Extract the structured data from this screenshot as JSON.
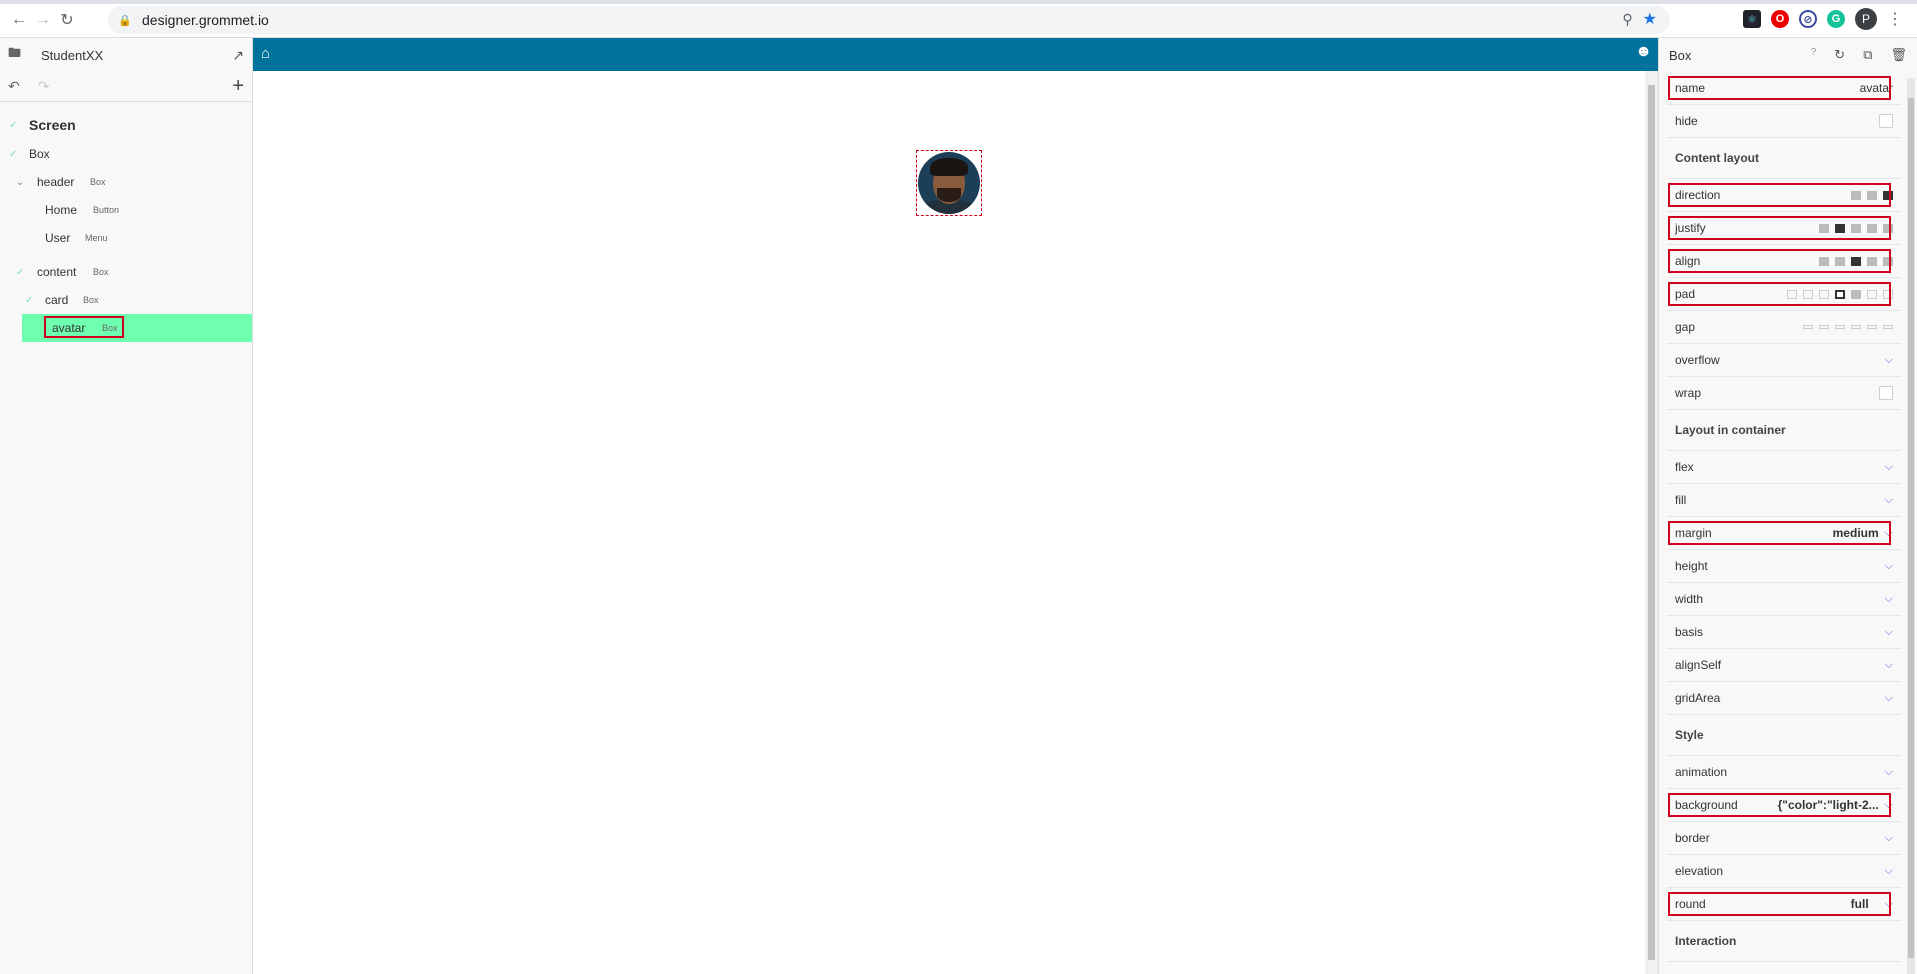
{
  "browser": {
    "url": "designer.grommet.io",
    "profile_initial": "P"
  },
  "left_panel": {
    "project_name": "StudentXX",
    "tree": [
      {
        "label": "Screen",
        "type": ""
      },
      {
        "label": "Box",
        "type": ""
      },
      {
        "label": "header",
        "type": "Box"
      },
      {
        "label": "Home",
        "type": "Button"
      },
      {
        "label": "User",
        "type": "Menu"
      },
      {
        "label": "content",
        "type": "Box"
      },
      {
        "label": "card",
        "type": "Box"
      },
      {
        "label": "avatar",
        "type": "Box"
      }
    ]
  },
  "right_panel": {
    "title": "Box",
    "help": "?",
    "name_label": "name",
    "name_value": "avatar",
    "hide_label": "hide",
    "content_layout_title": "Content layout",
    "direction_label": "direction",
    "justify_label": "justify",
    "align_label": "align",
    "pad_label": "pad",
    "gap_label": "gap",
    "overflow_label": "overflow",
    "wrap_label": "wrap",
    "layout_container_title": "Layout in container",
    "flex_label": "flex",
    "fill_label": "fill",
    "margin_label": "margin",
    "margin_value": "medium",
    "height_label": "height",
    "width_label": "width",
    "basis_label": "basis",
    "alignself_label": "alignSelf",
    "gridarea_label": "gridArea",
    "style_title": "Style",
    "animation_label": "animation",
    "background_label": "background",
    "background_value": "{\"color\":\"light-2...",
    "border_label": "border",
    "elevation_label": "elevation",
    "round_label": "round",
    "round_value": "full",
    "interaction_title": "Interaction"
  },
  "colors": {
    "canvas_header": "#00739d",
    "selected_node": "#6fffb0",
    "highlight": "#d0021b",
    "accent": "#7d4cdb"
  }
}
